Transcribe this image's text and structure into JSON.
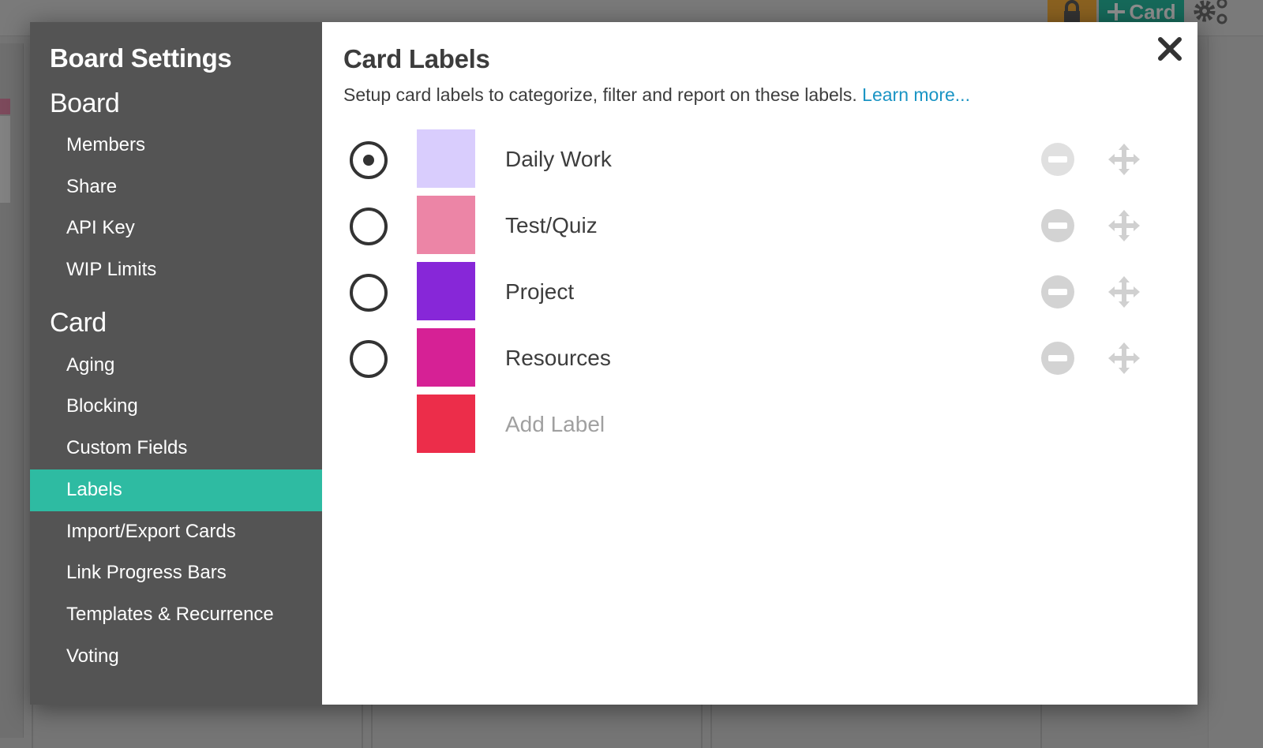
{
  "background": {
    "add_card_label": "Card",
    "add_card_icon": "plus-icon",
    "lock_icon": "lock-icon",
    "settings_icon": "gears-icon"
  },
  "sidebar": {
    "title": "Board Settings",
    "sections": [
      {
        "label": "Board",
        "items": [
          {
            "label": "Members",
            "active": false
          },
          {
            "label": "Share",
            "active": false
          },
          {
            "label": "API Key",
            "active": false
          },
          {
            "label": "WIP Limits",
            "active": false
          }
        ]
      },
      {
        "label": "Card",
        "items": [
          {
            "label": "Aging",
            "active": false
          },
          {
            "label": "Blocking",
            "active": false
          },
          {
            "label": "Custom Fields",
            "active": false
          },
          {
            "label": "Labels",
            "active": true
          },
          {
            "label": "Import/Export Cards",
            "active": false
          },
          {
            "label": "Link Progress Bars",
            "active": false
          },
          {
            "label": "Templates & Recurrence",
            "active": false
          },
          {
            "label": "Voting",
            "active": false
          }
        ]
      }
    ]
  },
  "content": {
    "title": "Card Labels",
    "description": "Setup card labels to categorize, filter and report on these labels.",
    "learn_more": "Learn more...",
    "close_icon": "close-icon",
    "labels": [
      {
        "name": "Daily Work",
        "color": "#d9cdfd",
        "default": true
      },
      {
        "name": "Test/Quiz",
        "color": "#ec85a6",
        "default": false
      },
      {
        "name": "Project",
        "color": "#8727d8",
        "default": false
      },
      {
        "name": "Resources",
        "color": "#d62195",
        "default": false
      }
    ],
    "new_label": {
      "placeholder": "Add Label",
      "color": "#ec2d4a"
    }
  },
  "colors": {
    "sidebar_bg": "#545454",
    "active_item": "#2ebba2",
    "link": "#1a94c4",
    "add_card_button": "#16695a",
    "lock_button": "#8a6120"
  }
}
